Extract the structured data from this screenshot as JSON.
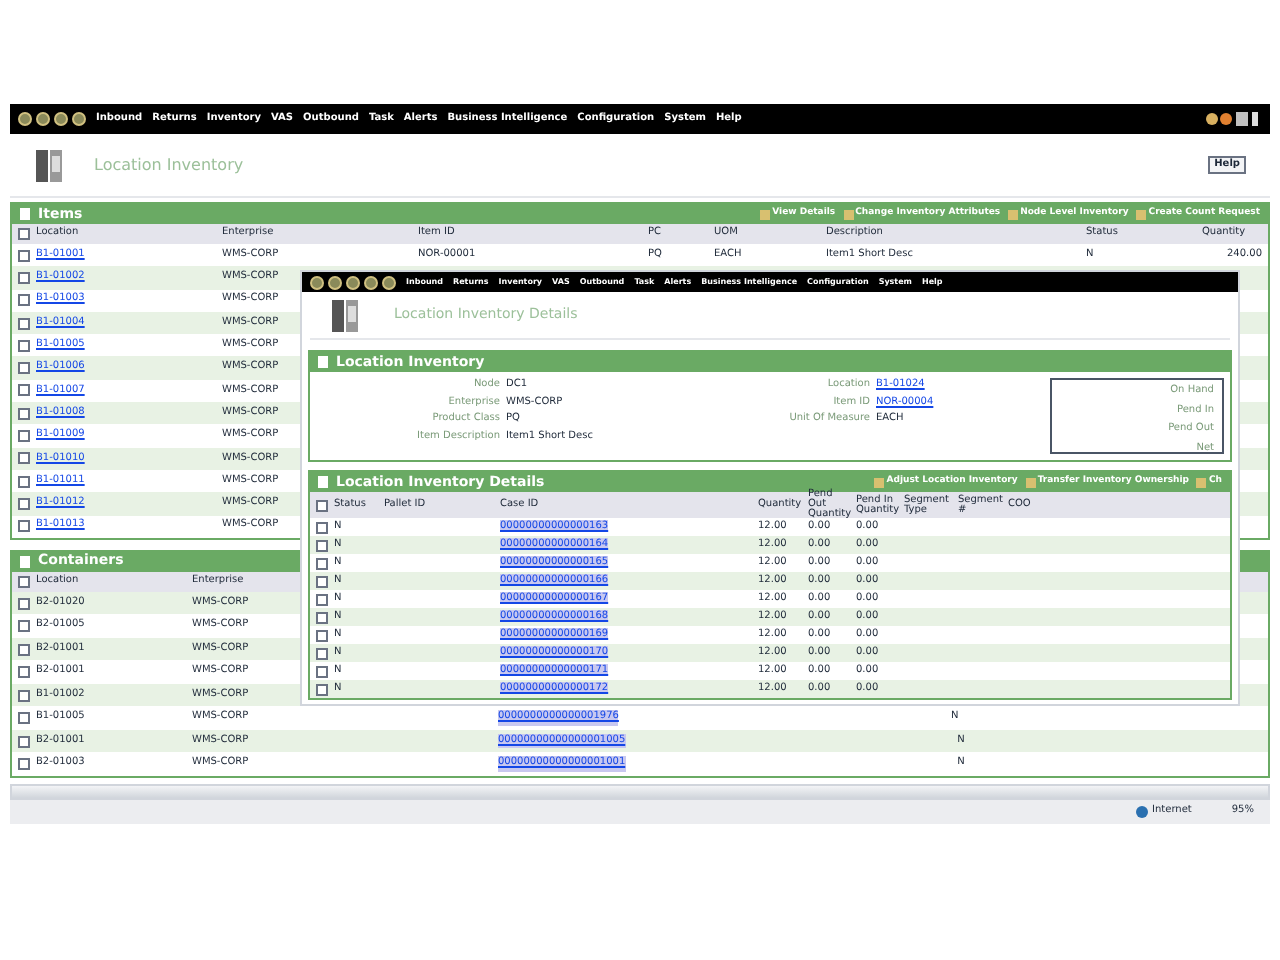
{
  "menu": [
    "Inbound",
    "Returns",
    "Inventory",
    "VAS",
    "Outbound",
    "Task",
    "Alerts",
    "Business Intelligence",
    "Configuration",
    "System",
    "Help"
  ],
  "page_title": "Location Inventory",
  "help_button": "Help",
  "items": {
    "title": "Items",
    "actions": [
      "View Details",
      "Change Inventory Attributes",
      "Node Level Inventory",
      "Create Count Request"
    ],
    "all_checked": false,
    "columns": [
      "Location",
      "Enterprise",
      "Item ID",
      "PC",
      "UOM",
      "Description",
      "Status",
      "Quantity"
    ],
    "rows": [
      {
        "checked": false,
        "cells": [
          "B1-01001",
          "WMS-CORP",
          "NOR-00001",
          "PQ",
          "EACH",
          "Item1 Short Desc",
          "N",
          "240.00"
        ]
      },
      {
        "checked": false,
        "cells": [
          "B1-01002",
          "WMS-CORP"
        ]
      },
      {
        "checked": false,
        "cells": [
          "B1-01003",
          "WMS-CORP"
        ]
      },
      {
        "checked": false,
        "cells": [
          "B1-01004",
          "WMS-CORP"
        ]
      },
      {
        "checked": false,
        "cells": [
          "B1-01005",
          "WMS-CORP"
        ]
      },
      {
        "checked": false,
        "cells": [
          "B1-01006",
          "WMS-CORP"
        ]
      },
      {
        "checked": false,
        "cells": [
          "B1-01007",
          "WMS-CORP"
        ]
      },
      {
        "checked": false,
        "cells": [
          "B1-01008",
          "WMS-CORP"
        ]
      },
      {
        "checked": false,
        "cells": [
          "B1-01009",
          "WMS-CORP"
        ]
      },
      {
        "checked": false,
        "cells": [
          "B1-01010",
          "WMS-CORP"
        ]
      },
      {
        "checked": false,
        "cells": [
          "B1-01011",
          "WMS-CORP"
        ]
      },
      {
        "checked": false,
        "cells": [
          "B1-01012",
          "WMS-CORP"
        ]
      },
      {
        "checked": false,
        "cells": [
          "B1-01013",
          "WMS-CORP"
        ]
      }
    ]
  },
  "containers": {
    "title": "Containers",
    "all_checked": false,
    "columns": [
      "Location",
      "Enterprise"
    ],
    "rows": [
      {
        "checked": false,
        "location": "B2-01020",
        "enterprise": "WMS-CORP"
      },
      {
        "checked": false,
        "location": "B2-01005",
        "enterprise": "WMS-CORP"
      },
      {
        "checked": false,
        "location": "B2-01001",
        "enterprise": "WMS-CORP"
      },
      {
        "checked": false,
        "location": "B2-01001",
        "enterprise": "WMS-CORP"
      },
      {
        "checked": false,
        "location": "B1-01002",
        "enterprise": "WMS-CORP"
      },
      {
        "checked": false,
        "location": "B1-01005",
        "enterprise": "WMS-CORP",
        "case_id": "0000000000000001976",
        "status": "N"
      },
      {
        "checked": false,
        "location": "B2-01001",
        "enterprise": "WMS-CORP",
        "case_id": "00000000000000001005",
        "status": "N"
      },
      {
        "checked": false,
        "location": "B2-01003",
        "enterprise": "WMS-CORP",
        "case_id": "00000000000000001001",
        "status": "N"
      }
    ]
  },
  "details_window": {
    "menu": [
      "Inbound",
      "Returns",
      "Inventory",
      "VAS",
      "Outbound",
      "Task",
      "Alerts",
      "Business Intelligence",
      "Configuration",
      "System",
      "Help"
    ],
    "title": "Location Inventory Details",
    "summary": {
      "title": "Location Inventory",
      "left": [
        {
          "label": "Node",
          "value": "DC1"
        },
        {
          "label": "Enterprise",
          "value": "WMS-CORP"
        },
        {
          "label": "Product Class",
          "value": "PQ"
        },
        {
          "label": "Item Description",
          "value": "Item1 Short Desc"
        }
      ],
      "middle": [
        {
          "label": "Location",
          "value": "B1-01024",
          "link": true
        },
        {
          "label": "Item ID",
          "value": "NOR-00004",
          "link": true
        },
        {
          "label": "Unit Of Measure",
          "value": "EACH",
          "link": false
        }
      ],
      "totals": [
        "On Hand",
        "Pend In",
        "Pend Out",
        "Net"
      ]
    },
    "table": {
      "title": "Location Inventory Details",
      "actions": [
        "Adjust Location Inventory",
        "Transfer Inventory Ownership",
        "Ch"
      ],
      "all_checked": false,
      "columns": [
        "Status",
        "Pallet ID",
        "Case ID",
        "Quantity",
        "Pend Out Quantity",
        "Pend In Quantity",
        "Segment Type",
        "Segment #",
        "COO"
      ],
      "rows": [
        {
          "checked": false,
          "status": "N",
          "case_id": "00000000000000163",
          "quantity": "12.00",
          "pend_out": "0.00",
          "pend_in": "0.00"
        },
        {
          "checked": false,
          "status": "N",
          "case_id": "00000000000000164",
          "quantity": "12.00",
          "pend_out": "0.00",
          "pend_in": "0.00"
        },
        {
          "checked": false,
          "status": "N",
          "case_id": "00000000000000165",
          "quantity": "12.00",
          "pend_out": "0.00",
          "pend_in": "0.00"
        },
        {
          "checked": false,
          "status": "N",
          "case_id": "00000000000000166",
          "quantity": "12.00",
          "pend_out": "0.00",
          "pend_in": "0.00"
        },
        {
          "checked": false,
          "status": "N",
          "case_id": "00000000000000167",
          "quantity": "12.00",
          "pend_out": "0.00",
          "pend_in": "0.00"
        },
        {
          "checked": false,
          "status": "N",
          "case_id": "00000000000000168",
          "quantity": "12.00",
          "pend_out": "0.00",
          "pend_in": "0.00"
        },
        {
          "checked": false,
          "status": "N",
          "case_id": "00000000000000169",
          "quantity": "12.00",
          "pend_out": "0.00",
          "pend_in": "0.00"
        },
        {
          "checked": false,
          "status": "N",
          "case_id": "00000000000000170",
          "quantity": "12.00",
          "pend_out": "0.00",
          "pend_in": "0.00"
        },
        {
          "checked": false,
          "status": "N",
          "case_id": "00000000000000171",
          "quantity": "12.00",
          "pend_out": "0.00",
          "pend_in": "0.00"
        },
        {
          "checked": false,
          "status": "N",
          "case_id": "00000000000000172",
          "quantity": "12.00",
          "pend_out": "0.00",
          "pend_in": "0.00"
        }
      ]
    }
  },
  "status_bar": {
    "zone": "Internet",
    "zoom": "95%"
  }
}
